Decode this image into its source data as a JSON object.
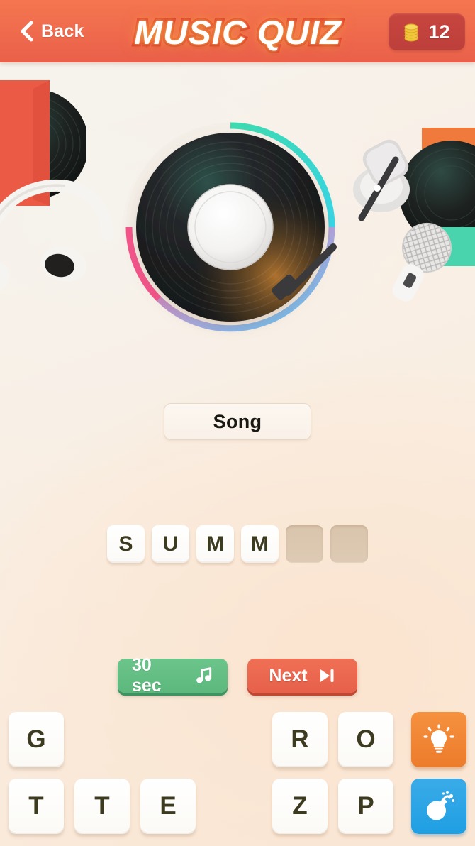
{
  "header": {
    "back_label": "Back",
    "back_icon": "chevron-left-icon",
    "title": "MUSIC QUIZ",
    "coin_icon": "coin-stack-icon",
    "coin_count": "12",
    "bar_color": "#ef6a4d",
    "title_stroke_color": "#e03a32",
    "coin_pill_color": "#c8453f"
  },
  "turntable": {
    "icon": "vinyl-record-turntable",
    "ring_colors": [
      "#3ddbb0",
      "#35d6e8",
      "#7fb6e8",
      "#f5528a",
      "#ffffff"
    ],
    "tonearm_icon": "tonearm-icon"
  },
  "decor": {
    "left_sleeve": "album-sleeve-record-icon",
    "headphones": "headphones-icon",
    "right_sleeve": "album-sleeve-record-icon",
    "tonearm_base": "tonearm-base-icon",
    "microphone": "microphone-icon"
  },
  "category": {
    "label": "Song"
  },
  "answer": {
    "slots": [
      {
        "letter": "S",
        "state": "filled"
      },
      {
        "letter": "U",
        "state": "filled"
      },
      {
        "letter": "M",
        "state": "filled"
      },
      {
        "letter": "M",
        "state": "filled"
      },
      {
        "letter": "",
        "state": "empty"
      },
      {
        "letter": "",
        "state": "empty"
      }
    ]
  },
  "actions": {
    "play": {
      "label": "30 sec",
      "icon": "music-note-icon",
      "color": "#5cb87d"
    },
    "next": {
      "label": "Next",
      "icon": "skip-forward-icon",
      "color": "#e7604a"
    }
  },
  "keyboard": {
    "rows": [
      [
        {
          "letter": "G",
          "state": "available"
        },
        {
          "letter": "",
          "state": "used"
        },
        {
          "letter": "",
          "state": "used"
        },
        {
          "letter": "",
          "state": "used"
        },
        {
          "letter": "R",
          "state": "available"
        },
        {
          "letter": "O",
          "state": "available"
        }
      ],
      [
        {
          "letter": "T",
          "state": "available"
        },
        {
          "letter": "T",
          "state": "available"
        },
        {
          "letter": "E",
          "state": "available"
        },
        {
          "letter": "",
          "state": "used"
        },
        {
          "letter": "Z",
          "state": "available"
        },
        {
          "letter": "P",
          "state": "available"
        }
      ]
    ],
    "powerups": [
      {
        "name": "hint",
        "icon": "lightbulb-icon",
        "color": "#ec7c2c"
      },
      {
        "name": "bomb",
        "icon": "bomb-icon",
        "color": "#1f9fe3"
      }
    ]
  }
}
